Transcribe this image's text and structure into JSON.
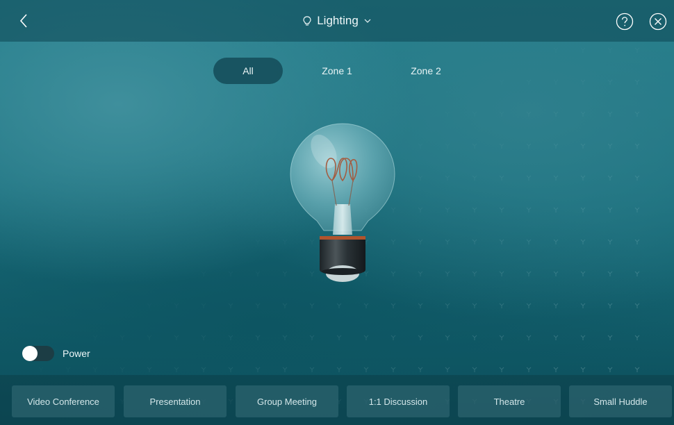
{
  "header": {
    "title": "Lighting"
  },
  "tabs": [
    {
      "label": "All",
      "active": true
    },
    {
      "label": "Zone 1",
      "active": false
    },
    {
      "label": "Zone 2",
      "active": false
    }
  ],
  "power": {
    "label": "Power",
    "on": false
  },
  "scenes": [
    {
      "label": "Video Conference"
    },
    {
      "label": "Presentation"
    },
    {
      "label": "Group Meeting"
    },
    {
      "label": "1:1 Discussion"
    },
    {
      "label": "Theatre"
    },
    {
      "label": "Small Huddle"
    }
  ],
  "colors": {
    "accent": "#ffffff",
    "background": "#1a6f7d",
    "toggle_track": "#1c3d45"
  }
}
